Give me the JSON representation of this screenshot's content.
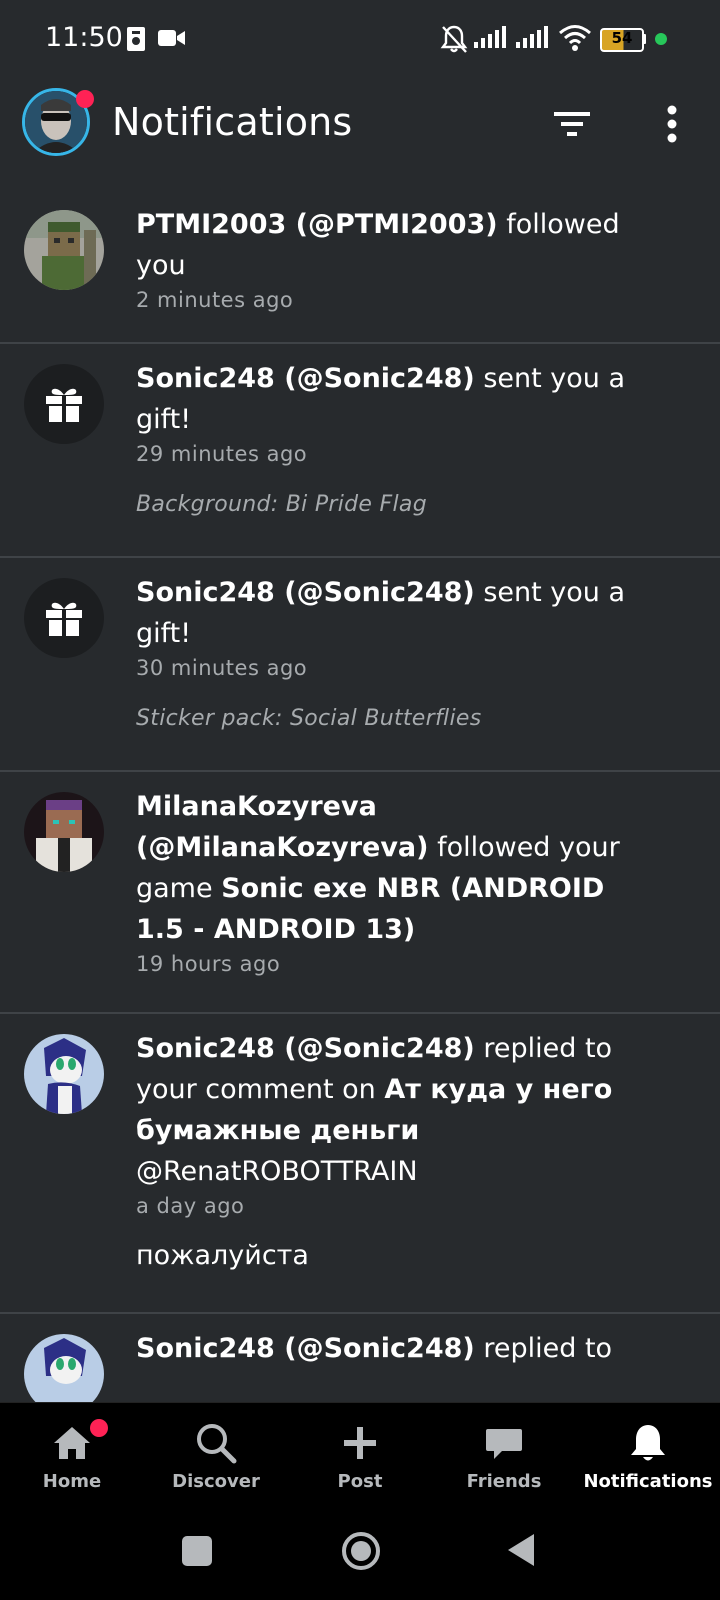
{
  "status_bar": {
    "time": "11:50",
    "battery": "54",
    "icons": [
      "nfc-icon",
      "video-camera-icon",
      "bell-muted-icon",
      "signal-icon",
      "signal-icon",
      "wifi-icon",
      "battery-icon",
      "green-dot-icon"
    ]
  },
  "header": {
    "title": "Notifications",
    "filter_icon": "filter-icon",
    "more_icon": "more-vert-icon"
  },
  "notifications": [
    {
      "kind": "avatar",
      "user": "PTMI2003 (@PTMI2003)",
      "action": " followed you",
      "time": "2 minutes ago"
    },
    {
      "kind": "gift",
      "user": "Sonic248 (@Sonic248)",
      "action": " sent you a gift!",
      "time": "29 minutes ago",
      "detail": "Background: Bi Pride Flag"
    },
    {
      "kind": "gift",
      "user": "Sonic248 (@Sonic248)",
      "action": " sent you a gift!",
      "time": "30 minutes ago",
      "detail": "Sticker pack: Social Butterflies"
    },
    {
      "kind": "avatar",
      "user": "MilanaKozyreva (@MilanaKozyreva)",
      "action": " followed your game ",
      "object": "Sonic exe NBR (ANDROID 1.5 - ANDROID 13)",
      "time": "19 hours ago"
    },
    {
      "kind": "avatar",
      "user": "Sonic248 (@Sonic248)",
      "action": " replied to your comment on ",
      "object": "Ат куда у него бумажные деньги",
      "mention": " @RenatROBOTTRAIN",
      "time": "a day ago",
      "reply": "пожалуйста"
    },
    {
      "kind": "avatar",
      "user": "Sonic248 (@Sonic248)",
      "action": " replied to"
    }
  ],
  "bottom_nav": [
    {
      "label": "Home",
      "icon": "home-icon"
    },
    {
      "label": "Discover",
      "icon": "search-icon"
    },
    {
      "label": "Post",
      "icon": "plus-icon"
    },
    {
      "label": "Friends",
      "icon": "chat-bubble-icon"
    },
    {
      "label": "Notifications",
      "icon": "bell-icon",
      "active": true
    }
  ],
  "system_nav": [
    "recents-icon",
    "home-circle-icon",
    "back-icon"
  ]
}
